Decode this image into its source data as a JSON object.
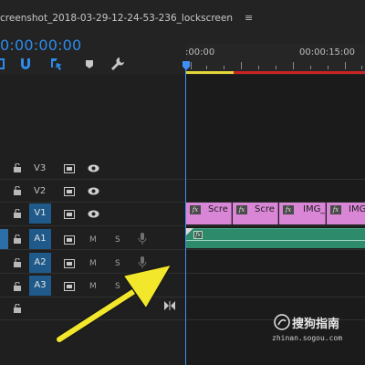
{
  "sequence": {
    "title": "creenshot_2018-03-29-12-24-53-236_lockscreen",
    "menu_icon": "hamburger-menu-icon",
    "timecode": "0:00:00:00"
  },
  "toolbar": {
    "icons": [
      "insert-nest-icon",
      "snap-magnet-icon",
      "linked-selection-icon",
      "add-marker-icon",
      "wrench-settings-icon"
    ]
  },
  "ruler": {
    "labels": [
      ":00:00",
      "00:00:15:00"
    ]
  },
  "tracks": {
    "video": [
      {
        "name": "V3",
        "source_label": "",
        "icons": [
          "lock-icon",
          "film-icon",
          "eye-icon"
        ]
      },
      {
        "name": "V2",
        "source_label": "",
        "icons": [
          "lock-icon",
          "film-icon",
          "eye-icon"
        ]
      },
      {
        "name": "V1",
        "source_label": "V1",
        "icons": [
          "lock-icon",
          "film-icon",
          "eye-icon"
        ]
      }
    ],
    "audio": [
      {
        "name": "A1",
        "source_label": "A1",
        "mute": "M",
        "solo": "S",
        "icons": [
          "lock-icon",
          "film-icon",
          "mic-icon"
        ]
      },
      {
        "name": "A2",
        "source_label": "A2",
        "mute": "M",
        "solo": "S",
        "icons": [
          "lock-icon",
          "film-icon",
          "mic-icon"
        ]
      },
      {
        "name": "A3",
        "source_label": "A3",
        "mute": "M",
        "solo": "S",
        "icons": [
          "lock-icon",
          "film-icon",
          "mic-icon"
        ]
      }
    ]
  },
  "clips": {
    "video": [
      {
        "label": "Scre",
        "badge": "fx"
      },
      {
        "label": "Scre",
        "badge": "fx"
      },
      {
        "label": "IMG_",
        "badge": "fx"
      },
      {
        "label": "IMG_",
        "badge": "fx"
      }
    ],
    "audio": [
      {
        "badge": "fx"
      }
    ]
  },
  "colors": {
    "timecode": "#2d8ceb",
    "playhead": "#3f8ff5",
    "video_clip": "#d986d6",
    "audio_clip": "#2d8a6a",
    "annotation_arrow": "#f3e72b",
    "active_track": "#1f5a8a"
  },
  "watermark": {
    "brand": "搜狗指南",
    "url": "zhinan.sogou.com"
  }
}
